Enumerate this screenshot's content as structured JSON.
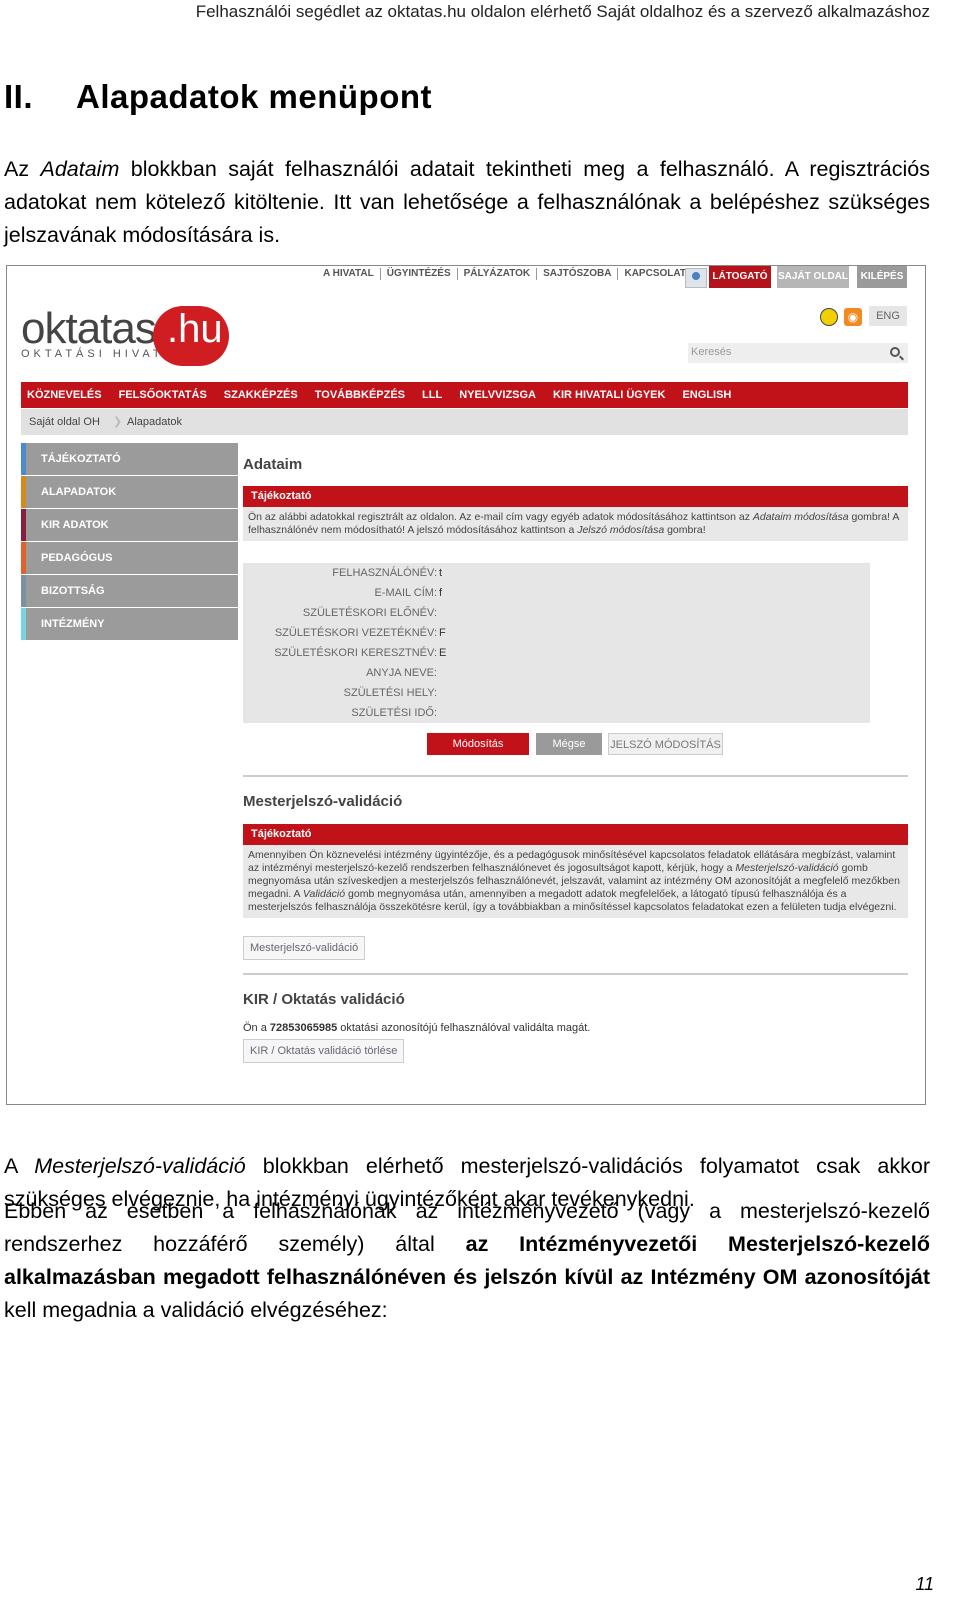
{
  "doc": {
    "header": "Felhasználói segédlet az oktatas.hu oldalon elérhető Saját oldalhoz és a szervező alkalmazáshoz",
    "section_number": "II.",
    "section_title": "Alapadatok menüpont",
    "p1_a": "Az ",
    "p1_italic": "Adataim",
    "p1_b": " blokkban saját felhasználói adatait tekintheti meg a felhasználó. A regisztrációs adatokat nem kötelező kitöltenie. Itt van lehetősége a felhasználónak a belépéshez szükséges jelszavának módosítására is.",
    "p2_a": "A ",
    "p2_italic": "Mesterjelszó-validáció",
    "p2_b": " blokkban elérhető mesterjelszó-validációs folyamatot csak akkor szükséges elvégeznie, ha intézményi ügyintézőként akar tevékenykedni.",
    "p3_a": "Ebben az esetben a felhasználónak az intézményvezető (vagy a mesterjelszó-kezelő rendszerhez hozzáférő személy) által ",
    "p3_bold1": "az Intézményvezetői Mesterjelszó-kezelő alkalmazásban megadott felhasználónéven és jelszón kívül az Intézmény OM azonosítóját",
    "p3_b": " kell megadnia a validáció elvégzéséhez:",
    "page_number": "11"
  },
  "shot": {
    "topnav": [
      "A HIVATAL",
      "ÜGYINTÉZÉS",
      "PÁLYÁZATOK",
      "SAJTÓSZOBA",
      "KAPCSOLAT"
    ],
    "btn_latogato": "LÁTOGATÓ",
    "btn_sajat": "SAJÁT OLDAL",
    "btn_kilepes": "KILÉPÉS",
    "logo_word": "oktatas",
    "logo_hu": ".hu",
    "logo_sub": "OKTATÁSI HIVATAL",
    "eng": "ENG",
    "search_placeholder": "Keresés",
    "mainnav": [
      "KÖZNEVELÉS",
      "FELSŐOKTATÁS",
      "SZAKKÉPZÉS",
      "TOVÁBBKÉPZÉS",
      "LLL",
      "NYELVVIZSGA",
      "KIR HIVATALI ÜGYEK",
      "ENGLISH"
    ],
    "crumbs": [
      "Saját oldal OH",
      "Alapadatok"
    ],
    "sidebar": [
      "TÁJÉKOZTATÓ",
      "ALAPADATOK",
      "KIR ADATOK",
      "PEDAGÓGUS",
      "BIZOTTSÁG",
      "INTÉZMÉNY"
    ],
    "sidebar_colors": [
      "#4a8bd0",
      "#d48a1c",
      "#8a1f3c",
      "#e0612a",
      "#7d8fa3",
      "#7ad3e0"
    ],
    "adataim_title": "Adataim",
    "info_label": "Tájékoztató",
    "info1_a": "Ön az alábbi adatokkal regisztrált az oldalon. Az e-mail cím vagy egyéb adatok módosításához kattintson az ",
    "info1_i1": "Adataim módosítása",
    "info1_b": " gombra! A felhasználónév nem módosítható! A jelszó módosításához kattintson a ",
    "info1_i2": "Jelszó módosítása",
    "info1_c": " gombra!",
    "fields": [
      {
        "label": "FELHASZNÁLÓNÉV:",
        "value": "t"
      },
      {
        "label": "E-MAIL CÍM:",
        "value": "f"
      },
      {
        "label": "SZÜLETÉSKORI ELŐNÉV:",
        "value": ""
      },
      {
        "label": "SZÜLETÉSKORI VEZETÉKNÉV:",
        "value": "F"
      },
      {
        "label": "SZÜLETÉSKORI KERESZTNÉV:",
        "value": "E"
      },
      {
        "label": "ANYJA NEVE:",
        "value": ""
      },
      {
        "label": "SZÜLETÉSI HELY:",
        "value": ""
      },
      {
        "label": "SZÜLETÉSI IDŐ:",
        "value": ""
      }
    ],
    "btn_modositas": "Módosítás",
    "btn_megse": "Mégse",
    "btn_jelszo": "JELSZÓ MÓDOSÍTÁS",
    "mv_title": "Mesterjelszó-validáció",
    "mv_info_a": "Amennyiben Ön köznevelési intézmény ügyintézője, és a pedagógusok minősítésével kapcsolatos feladatok ellátására megbízást, valamint az intézményi mesterjelszó-kezelő rendszerben felhasználónevet és jogosultságot kapott, kérjük, hogy a ",
    "mv_info_i1": "Mesterjelszó-validáció",
    "mv_info_b": " gomb megnyomása után szíveskedjen a mesterjelszós felhasználónevét, jelszavát, valamint az intézmény OM azonosítóját a megfelelő mezőkben megadni. A ",
    "mv_info_i2": "Validáció",
    "mv_info_c": " gomb megnyomása után, amennyiben a megadott adatok megfelelőek, a látogató típusú felhasználója és a mesterjelszós felhasználója összekötésre kerül, így a továbbiakban a minősítéssel kapcsolatos feladatokat ezen a felületen tudja elvégezni.",
    "mv_button": "Mesterjelszó-validáció",
    "kir_title": "KIR / Oktatás validáció",
    "kir_text_a": "Ön a ",
    "kir_text_num": "72853065985",
    "kir_text_b": " oktatási azonosítójú felhasználóval validálta magát.",
    "kir_button": "KIR / Oktatás validáció törlése"
  }
}
